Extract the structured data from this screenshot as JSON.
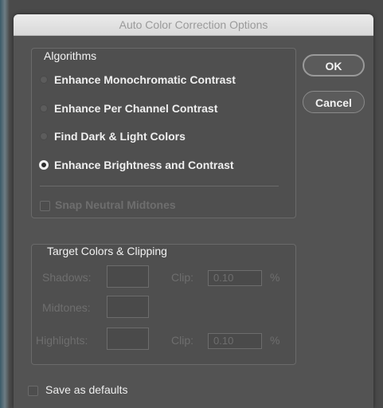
{
  "dialog": {
    "title": "Auto Color Correction Options"
  },
  "algorithms": {
    "title": "Algorithms",
    "options": [
      {
        "label": "Enhance Monochromatic Contrast",
        "selected": false
      },
      {
        "label": "Enhance Per Channel Contrast",
        "selected": false
      },
      {
        "label": "Find Dark & Light Colors",
        "selected": false
      },
      {
        "label": "Enhance Brightness and Contrast",
        "selected": true
      }
    ],
    "snap_neutral_midtones": {
      "label": "Snap Neutral Midtones",
      "checked": false,
      "enabled": false
    }
  },
  "target": {
    "title": "Target Colors & Clipping",
    "shadows_label": "Shadows:",
    "midtones_label": "Midtones:",
    "highlights_label": "Highlights:",
    "clip_label": "Clip:",
    "shadows_clip": "0.10",
    "highlights_clip": "0.10",
    "percent": "%"
  },
  "buttons": {
    "ok": "OK",
    "cancel": "Cancel"
  },
  "save_defaults": {
    "label": "Save as defaults",
    "checked": false
  }
}
